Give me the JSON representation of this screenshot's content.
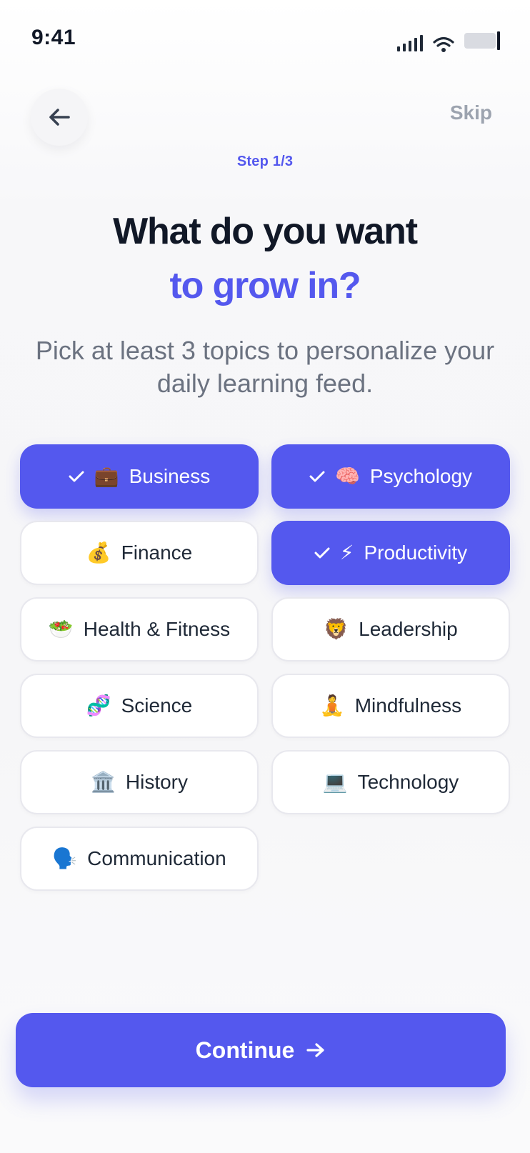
{
  "status_bar": {
    "time": "9:41"
  },
  "header": {
    "back_icon": "arrow-left-icon",
    "skip_label": "Skip"
  },
  "step_label": "Step 1/3",
  "title": {
    "line1": "What do you want",
    "line2": "to grow in?"
  },
  "subtitle": "Pick at least 3 topics to personalize your daily learning feed.",
  "topics": [
    {
      "label": "Business",
      "emoji": "💼",
      "selected": true
    },
    {
      "label": "Psychology",
      "emoji": "🧠",
      "selected": true
    },
    {
      "label": "Finance",
      "emoji": "💰",
      "selected": false
    },
    {
      "label": "Productivity",
      "emoji": "⚡",
      "selected": true
    },
    {
      "label": "Health & Fitness",
      "emoji": "🥗",
      "selected": false
    },
    {
      "label": "Leadership",
      "emoji": "🦁",
      "selected": false
    },
    {
      "label": "Science",
      "emoji": "🧬",
      "selected": false
    },
    {
      "label": "Mindfulness",
      "emoji": "🧘",
      "selected": false
    },
    {
      "label": "History",
      "emoji": "🏛️",
      "selected": false
    },
    {
      "label": "Technology",
      "emoji": "💻",
      "selected": false
    },
    {
      "label": "Communication",
      "emoji": "🗣️",
      "selected": false
    }
  ],
  "continue": {
    "label": "Continue",
    "icon": "arrow-right-icon"
  },
  "colors": {
    "accent": "#5458EE",
    "title": "#111827",
    "muted": "#6B7280"
  }
}
